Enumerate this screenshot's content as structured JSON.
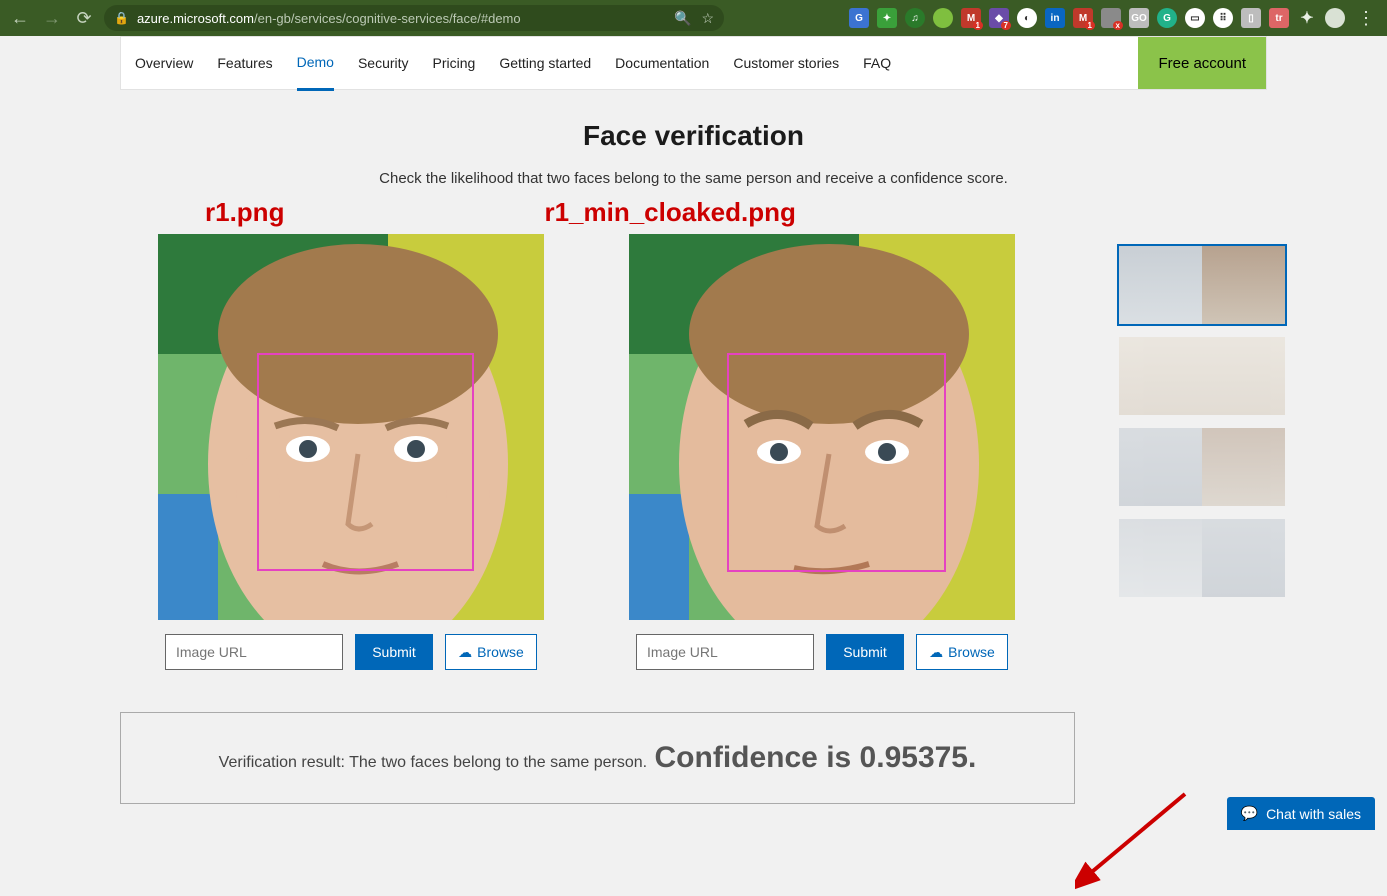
{
  "browser": {
    "url_host": "azure.microsoft.com",
    "url_path": "/en-gb/services/cognitive-services/face/#demo"
  },
  "nav": {
    "tabs": [
      "Overview",
      "Features",
      "Demo",
      "Security",
      "Pricing",
      "Getting started",
      "Documentation",
      "Customer stories",
      "FAQ"
    ],
    "active": "Demo",
    "cta": "Free account"
  },
  "page": {
    "title": "Face verification",
    "desc": "Check the likelihood that two faces belong to the same person and receive a confidence score."
  },
  "annotations": {
    "left_label": "r1.png",
    "right_label": "r1_min_cloaked.png"
  },
  "controls": {
    "placeholder": "Image URL",
    "submit": "Submit",
    "browse": "Browse"
  },
  "result": {
    "pre": "Verification result: The two faces belong to the same person. ",
    "emph": "Confidence is 0.95375."
  },
  "chat": {
    "label": "Chat with sales"
  },
  "extensions_badges": {
    "gmail1": "1",
    "purple": "7",
    "gmail2": "1",
    "grey": "x"
  }
}
